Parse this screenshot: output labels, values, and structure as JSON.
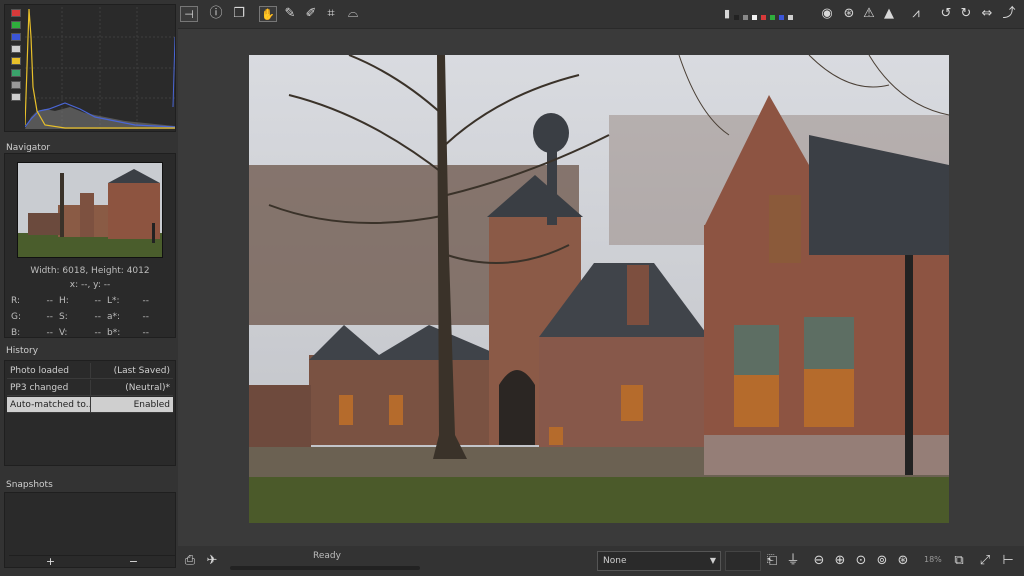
{
  "histogram": {
    "buttons": [
      {
        "name": "red",
        "color": "#d83a3a"
      },
      {
        "name": "green",
        "color": "#2fae3c"
      },
      {
        "name": "blue",
        "color": "#3b55d8"
      },
      {
        "name": "luminance",
        "color": "#cfcfcf"
      },
      {
        "name": "chroma",
        "color": "#e8c02a"
      },
      {
        "name": "raw",
        "color": "#3aa36b"
      },
      {
        "name": "bar",
        "color": "#9a9a9a"
      },
      {
        "name": "mode",
        "color": "#cfcfcf"
      }
    ]
  },
  "navigator": {
    "title": "Navigator",
    "dimensions": "Width: 6018, Height: 4012",
    "coords": "x: --, y: --",
    "rows": [
      [
        "R:",
        "--",
        "H:",
        "--",
        "L*:",
        "--"
      ],
      [
        "G:",
        "--",
        "S:",
        "--",
        "a*:",
        "--"
      ],
      [
        "B:",
        "--",
        "V:",
        "--",
        "b*:",
        "--"
      ]
    ]
  },
  "history": {
    "title": "History",
    "rows": [
      {
        "action": "Photo loaded",
        "value": "(Last Saved)"
      },
      {
        "action": "PP3 changed",
        "value": "(Neutral)*"
      },
      {
        "action": "Auto-matched to...",
        "value": "Enabled"
      }
    ]
  },
  "snapshots": {
    "title": "Snapshots",
    "add_label": "+",
    "remove_label": "−"
  },
  "toolbar": {
    "left_icons": [
      "hide-panel-icon",
      "info-icon",
      "before-after-icon",
      "hand-icon",
      "wb-picker-icon",
      "color-picker-icon",
      "crop-icon",
      "straighten-icon"
    ],
    "right_icons": [
      "focus-mask-icon",
      "gamut-icon",
      "shadow-clip-icon",
      "highlight-clip-icon",
      "histogram-toggle-icon",
      "rotate-left-icon",
      "rotate-right-icon",
      "flip-horizontal-icon",
      "flip-vertical-icon"
    ],
    "channel_swatches": [
      "#222222",
      "#888888",
      "#f2f2f2",
      "#d83a3a",
      "#2fae3c",
      "#3b55d8",
      "#cfcfcf"
    ]
  },
  "bottom": {
    "status": "Ready",
    "profile": "None",
    "zoom": "18%"
  }
}
